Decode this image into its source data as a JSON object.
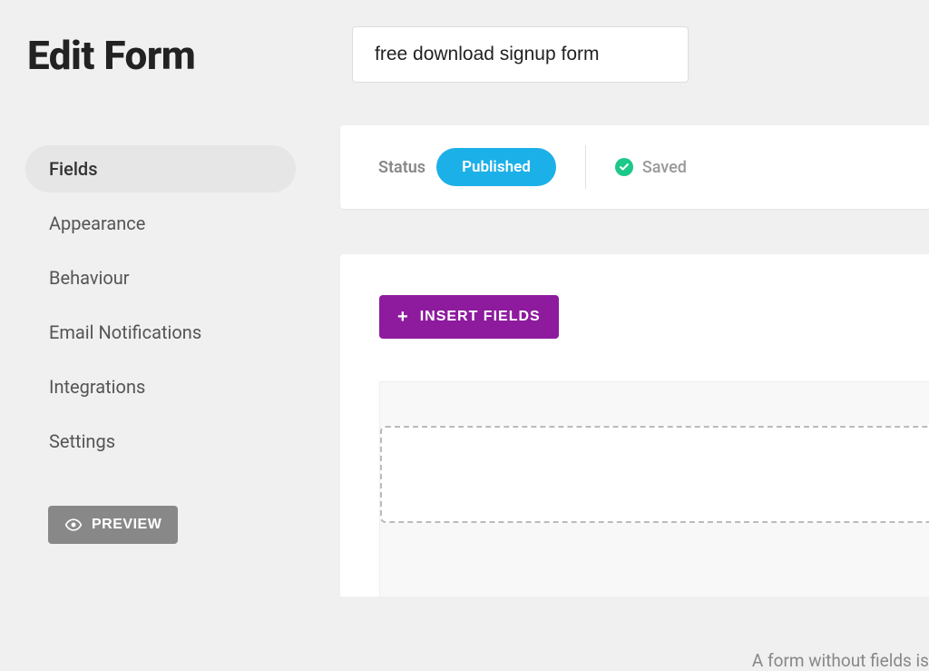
{
  "header": {
    "page_title": "Edit Form",
    "form_name": "free download signup form"
  },
  "sidebar": {
    "items": [
      {
        "label": "Fields",
        "active": true
      },
      {
        "label": "Appearance",
        "active": false
      },
      {
        "label": "Behaviour",
        "active": false
      },
      {
        "label": "Email Notifications",
        "active": false
      },
      {
        "label": "Integrations",
        "active": false
      },
      {
        "label": "Settings",
        "active": false
      }
    ],
    "preview_label": "PREVIEW"
  },
  "status_bar": {
    "status_label": "Status",
    "published_label": "Published",
    "saved_label": "Saved"
  },
  "main": {
    "insert_fields_label": "INSERT FIELDS",
    "empty_text": "A form without fields is"
  }
}
